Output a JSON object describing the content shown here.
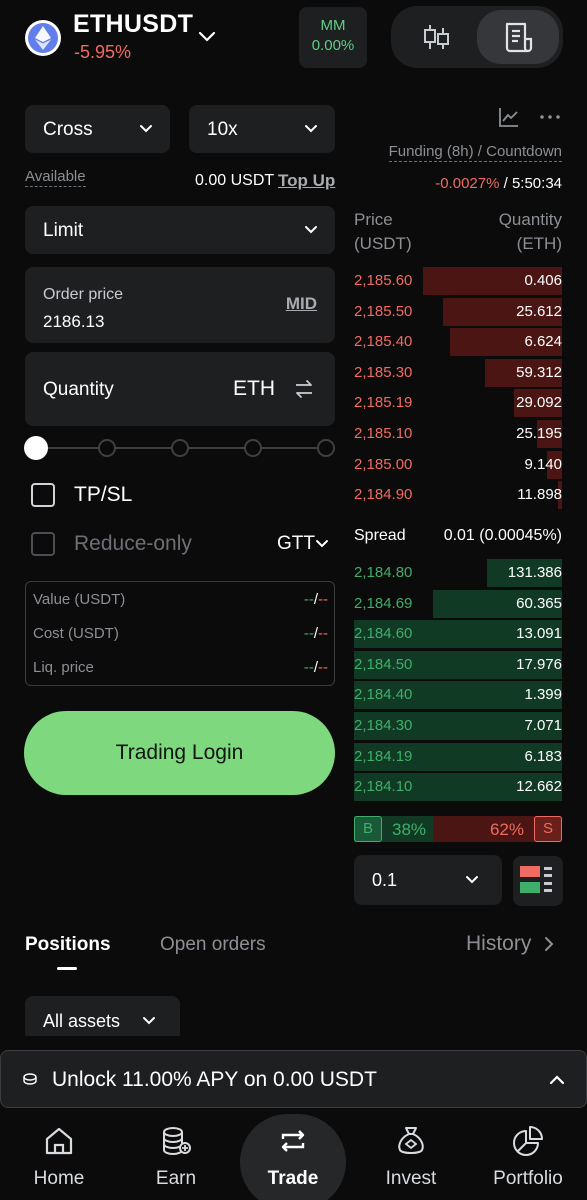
{
  "header": {
    "pair": "ETHUSDT",
    "change": "-5.95%",
    "mm_label": "MM",
    "mm_value": "0.00%"
  },
  "form": {
    "margin_mode": "Cross",
    "leverage": "10x",
    "available_label": "Available",
    "available_value": "0.00 USDT",
    "top_up": "Top Up",
    "order_type": "Limit",
    "order_price_label": "Order price",
    "order_price_value": "2186.13",
    "mid_label": "MID",
    "quantity_label": "Quantity",
    "quantity_unit": "ETH",
    "tpsl_label": "TP/SL",
    "reduce_only_label": "Reduce-only",
    "tif": "GTT",
    "summary": [
      {
        "label": "Value (USDT)"
      },
      {
        "label": "Cost (USDT)"
      },
      {
        "label": "Liq. price"
      }
    ],
    "summary_dash_a": "--",
    "summary_slash": "/",
    "summary_dash_b": "--",
    "login_button": "Trading Login"
  },
  "orderbook": {
    "funding_label": "Funding (8h) / Countdown",
    "funding_rate": "-0.0027%",
    "funding_sep": " / ",
    "countdown": "5:50:34",
    "price_header_1": "Price",
    "price_header_2": "(USDT)",
    "qty_header_1": "Quantity",
    "qty_header_2": "(ETH)",
    "asks": [
      {
        "price": "2,185.60",
        "qty": "0.406",
        "depth": 0.67
      },
      {
        "price": "2,185.50",
        "qty": "25.612",
        "depth": 0.57
      },
      {
        "price": "2,185.40",
        "qty": "6.624",
        "depth": 0.54
      },
      {
        "price": "2,185.30",
        "qty": "59.312",
        "depth": 0.37
      },
      {
        "price": "2,185.19",
        "qty": "29.092",
        "depth": 0.23
      },
      {
        "price": "2,185.10",
        "qty": "25.195",
        "depth": 0.12
      },
      {
        "price": "2,185.00",
        "qty": "9.140",
        "depth": 0.07
      },
      {
        "price": "2,184.90",
        "qty": "11.898",
        "depth": 0.02
      }
    ],
    "spread_label": "Spread",
    "spread_value": "0.01 (0.00045%)",
    "bids": [
      {
        "price": "2,184.80",
        "qty": "131.386",
        "depth": 0.36
      },
      {
        "price": "2,184.69",
        "qty": "60.365",
        "depth": 0.62
      },
      {
        "price": "2,184.60",
        "qty": "13.091",
        "depth": 1.0
      },
      {
        "price": "2,184.50",
        "qty": "17.976",
        "depth": 1.0
      },
      {
        "price": "2,184.40",
        "qty": "1.399",
        "depth": 1.0
      },
      {
        "price": "2,184.30",
        "qty": "7.071",
        "depth": 1.0
      },
      {
        "price": "2,184.19",
        "qty": "6.183",
        "depth": 1.0
      },
      {
        "price": "2,184.10",
        "qty": "12.662",
        "depth": 1.0
      }
    ],
    "buy_badge": "B",
    "sell_badge": "S",
    "buy_pct": "38%",
    "sell_pct": "62%",
    "buy_ratio": 0.38,
    "depth_step": "0.1"
  },
  "tabs": {
    "positions": "Positions",
    "open_orders": "Open orders",
    "history": "History",
    "filter": "All assets"
  },
  "banner": {
    "text": "Unlock 11.00% APY on 0.00 USDT"
  },
  "nav": {
    "home": "Home",
    "earn": "Earn",
    "trade": "Trade",
    "invest": "Invest",
    "portfolio": "Portfolio"
  },
  "colors": {
    "ask": "#f06b62",
    "bid": "#3fae6a",
    "accent_button": "#7ed87e",
    "background": "#0b0b0b"
  }
}
